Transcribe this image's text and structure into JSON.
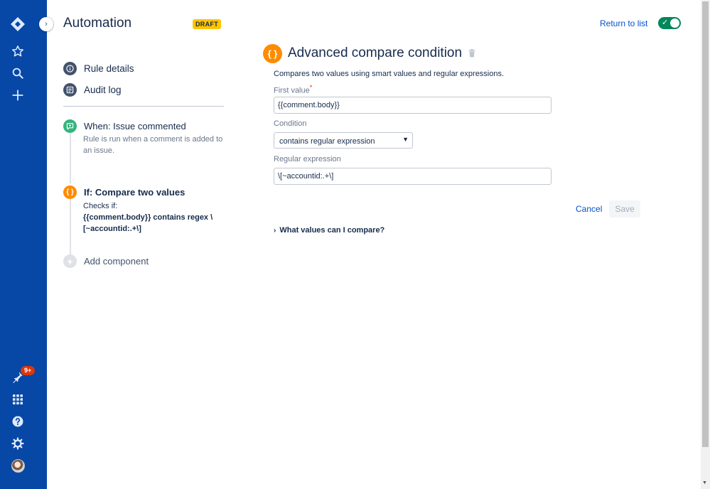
{
  "app": {
    "title": "Automation",
    "status_lozenge": "DRAFT"
  },
  "global_nav": {
    "notification_badge": "9+",
    "icons": [
      "jira-logo-icon",
      "star-icon",
      "search-icon",
      "create-plus-icon",
      "notifications-icon",
      "app-switcher-icon",
      "help-icon",
      "settings-icon",
      "avatar"
    ]
  },
  "sidebar": {
    "links": [
      {
        "label": "Rule details",
        "icon": "info-icon"
      },
      {
        "label": "Audit log",
        "icon": "list-icon"
      }
    ],
    "trigger": {
      "title": "When: Issue commented",
      "description": "Rule is run when a comment is added to an issue."
    },
    "condition": {
      "title": "If: Compare two values",
      "checks_label": "Checks if:",
      "checks_value": "{{comment.body}} contains regex \\[~accountid:.+\\]"
    },
    "add_component": "Add component"
  },
  "header": {
    "return_link": "Return to list",
    "toggle_enabled": true
  },
  "form": {
    "title": "Advanced compare condition",
    "description": "Compares two values using smart values and regular expressions.",
    "first_value_label": "First value",
    "first_value_required": "*",
    "first_value": "{{comment.body}}",
    "condition_label": "Condition",
    "condition_value": "contains regular expression",
    "regex_label": "Regular expression",
    "regex_value": "\\[~accountid:.+\\]",
    "cancel_label": "Cancel",
    "save_label": "Save",
    "expander_label": "What values can I compare?"
  },
  "colors": {
    "nav_bg": "#0747a6",
    "link": "#0052cc",
    "draft": "#ffc400",
    "trigger_green": "#36b37e",
    "condition_orange": "#ff8b00",
    "toggle_green": "#00875a"
  }
}
